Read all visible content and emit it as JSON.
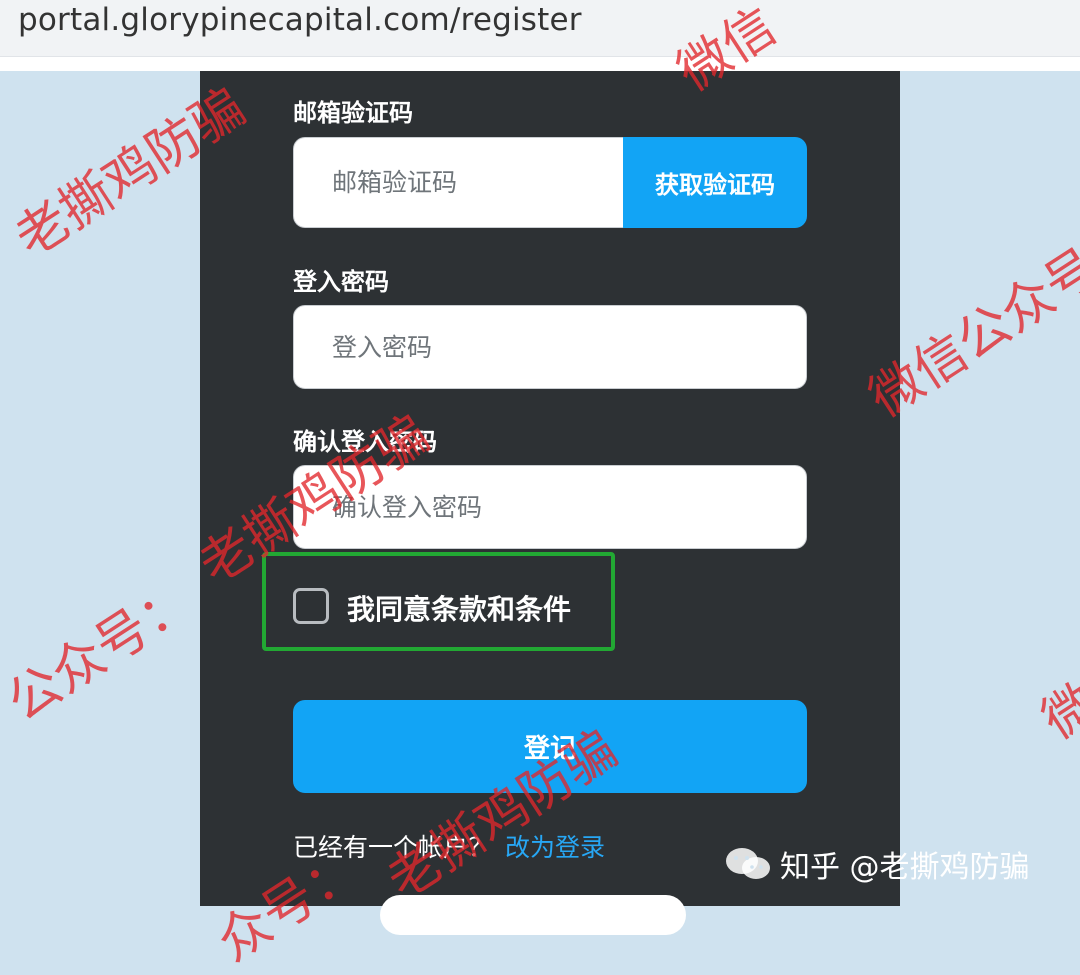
{
  "browser": {
    "url": "portal.glorypinecapital.com/register"
  },
  "form": {
    "email_code_label": "邮箱验证码",
    "email_code_placeholder": "邮箱验证码",
    "get_code_button": "获取验证码",
    "password_label": "登入密码",
    "password_placeholder": "登入密码",
    "confirm_password_label": "确认登入密码",
    "confirm_password_placeholder": "确认登入密码",
    "agree_label": "我同意条款和条件",
    "register_button": "登记",
    "have_account_text": "已经有一个帐户？",
    "login_link": "改为登录"
  },
  "watermarks": {
    "wm1": "老撕鸡防骗",
    "wm2": "微信公众号",
    "wm3": "老撕鸡防骗",
    "wm4": "公众号：",
    "wm5": "微信",
    "wm6": "老撕鸡防骗",
    "wm7": "众号：",
    "wm8": "微信",
    "wm9": "微"
  },
  "footer_mark": {
    "text": "知乎 @老撕鸡防骗",
    "icon": "wechat-icon"
  },
  "colors": {
    "accent": "#12a4f5",
    "panel": "#2d3134",
    "highlight_box": "#22a833",
    "watermark": "#e2272c"
  }
}
